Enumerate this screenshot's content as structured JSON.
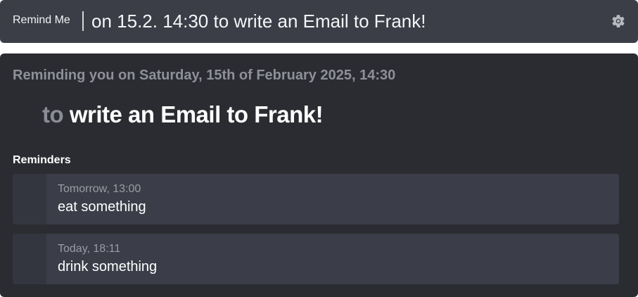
{
  "header": {
    "brand": "Remind Me",
    "command_value": "on 15.2. 14:30 to write an Email to Frank!",
    "settings_icon": "gear-icon"
  },
  "preview": {
    "reminding_text": "Reminding you on Saturday, 15th of February 2025, 14:30",
    "task_prefix": "to",
    "task_text": "write an Email to Frank!"
  },
  "reminders": {
    "title": "Reminders",
    "items": [
      {
        "time": "Tomorrow, 13:00",
        "text": "eat something"
      },
      {
        "time": "Today, 18:11",
        "text": "drink something"
      }
    ]
  },
  "colors": {
    "topbar_bg": "#3b3e47",
    "panel_bg": "#2b2c31",
    "card_bg": "#3b3e48",
    "muted_text": "#8e9099"
  }
}
